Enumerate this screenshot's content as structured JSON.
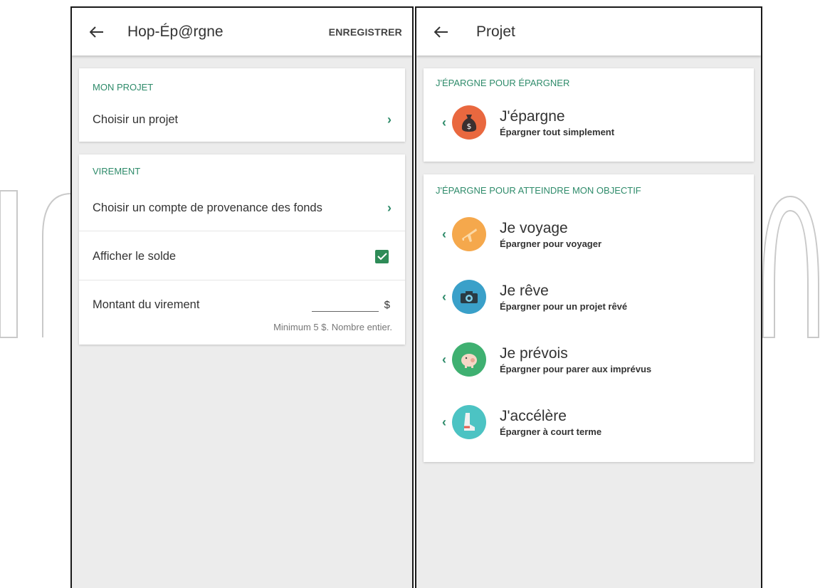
{
  "left": {
    "title": "Hop-Ép@rgne",
    "action": "ENREGISTRER",
    "sections": {
      "projet": {
        "title": "MON PROJET",
        "row_label": "Choisir un projet"
      },
      "virement": {
        "title": "VIREMENT",
        "compte_label": "Choisir un compte de provenance des fonds",
        "solde_label": "Afficher le solde",
        "solde_checked": true,
        "montant_label": "Montant du virement",
        "montant_value": "",
        "currency": "$",
        "hint": "Minimum 5 $. Nombre entier."
      }
    }
  },
  "right": {
    "title": "Projet",
    "section1": {
      "title": "J'ÉPARGNE POUR ÉPARGNER",
      "items": [
        {
          "title": "J'épargne",
          "subtitle": "Épargner tout simplement",
          "icon": "money-bag-icon",
          "color": "#e9683f"
        }
      ]
    },
    "section2": {
      "title": "J'ÉPARGNE POUR ATTEINDRE MON OBJECTIF",
      "items": [
        {
          "title": "Je voyage",
          "subtitle": "Épargner pour voyager",
          "icon": "airplane-icon",
          "color": "#f5a84c"
        },
        {
          "title": "Je rêve",
          "subtitle": "Épargner pour un projet rêvé",
          "icon": "camera-icon",
          "color": "#3aa0c9"
        },
        {
          "title": "Je prévois",
          "subtitle": "Épargner pour parer aux imprévus",
          "icon": "piggy-bank-icon",
          "color": "#3fb071"
        },
        {
          "title": "J'accélère",
          "subtitle": "Épargner à court terme",
          "icon": "running-shoe-icon",
          "color": "#4cc3c3"
        }
      ]
    }
  },
  "colors": {
    "accent": "#2e8b6a",
    "checkbox": "#2e8b57",
    "background": "#ececec"
  }
}
